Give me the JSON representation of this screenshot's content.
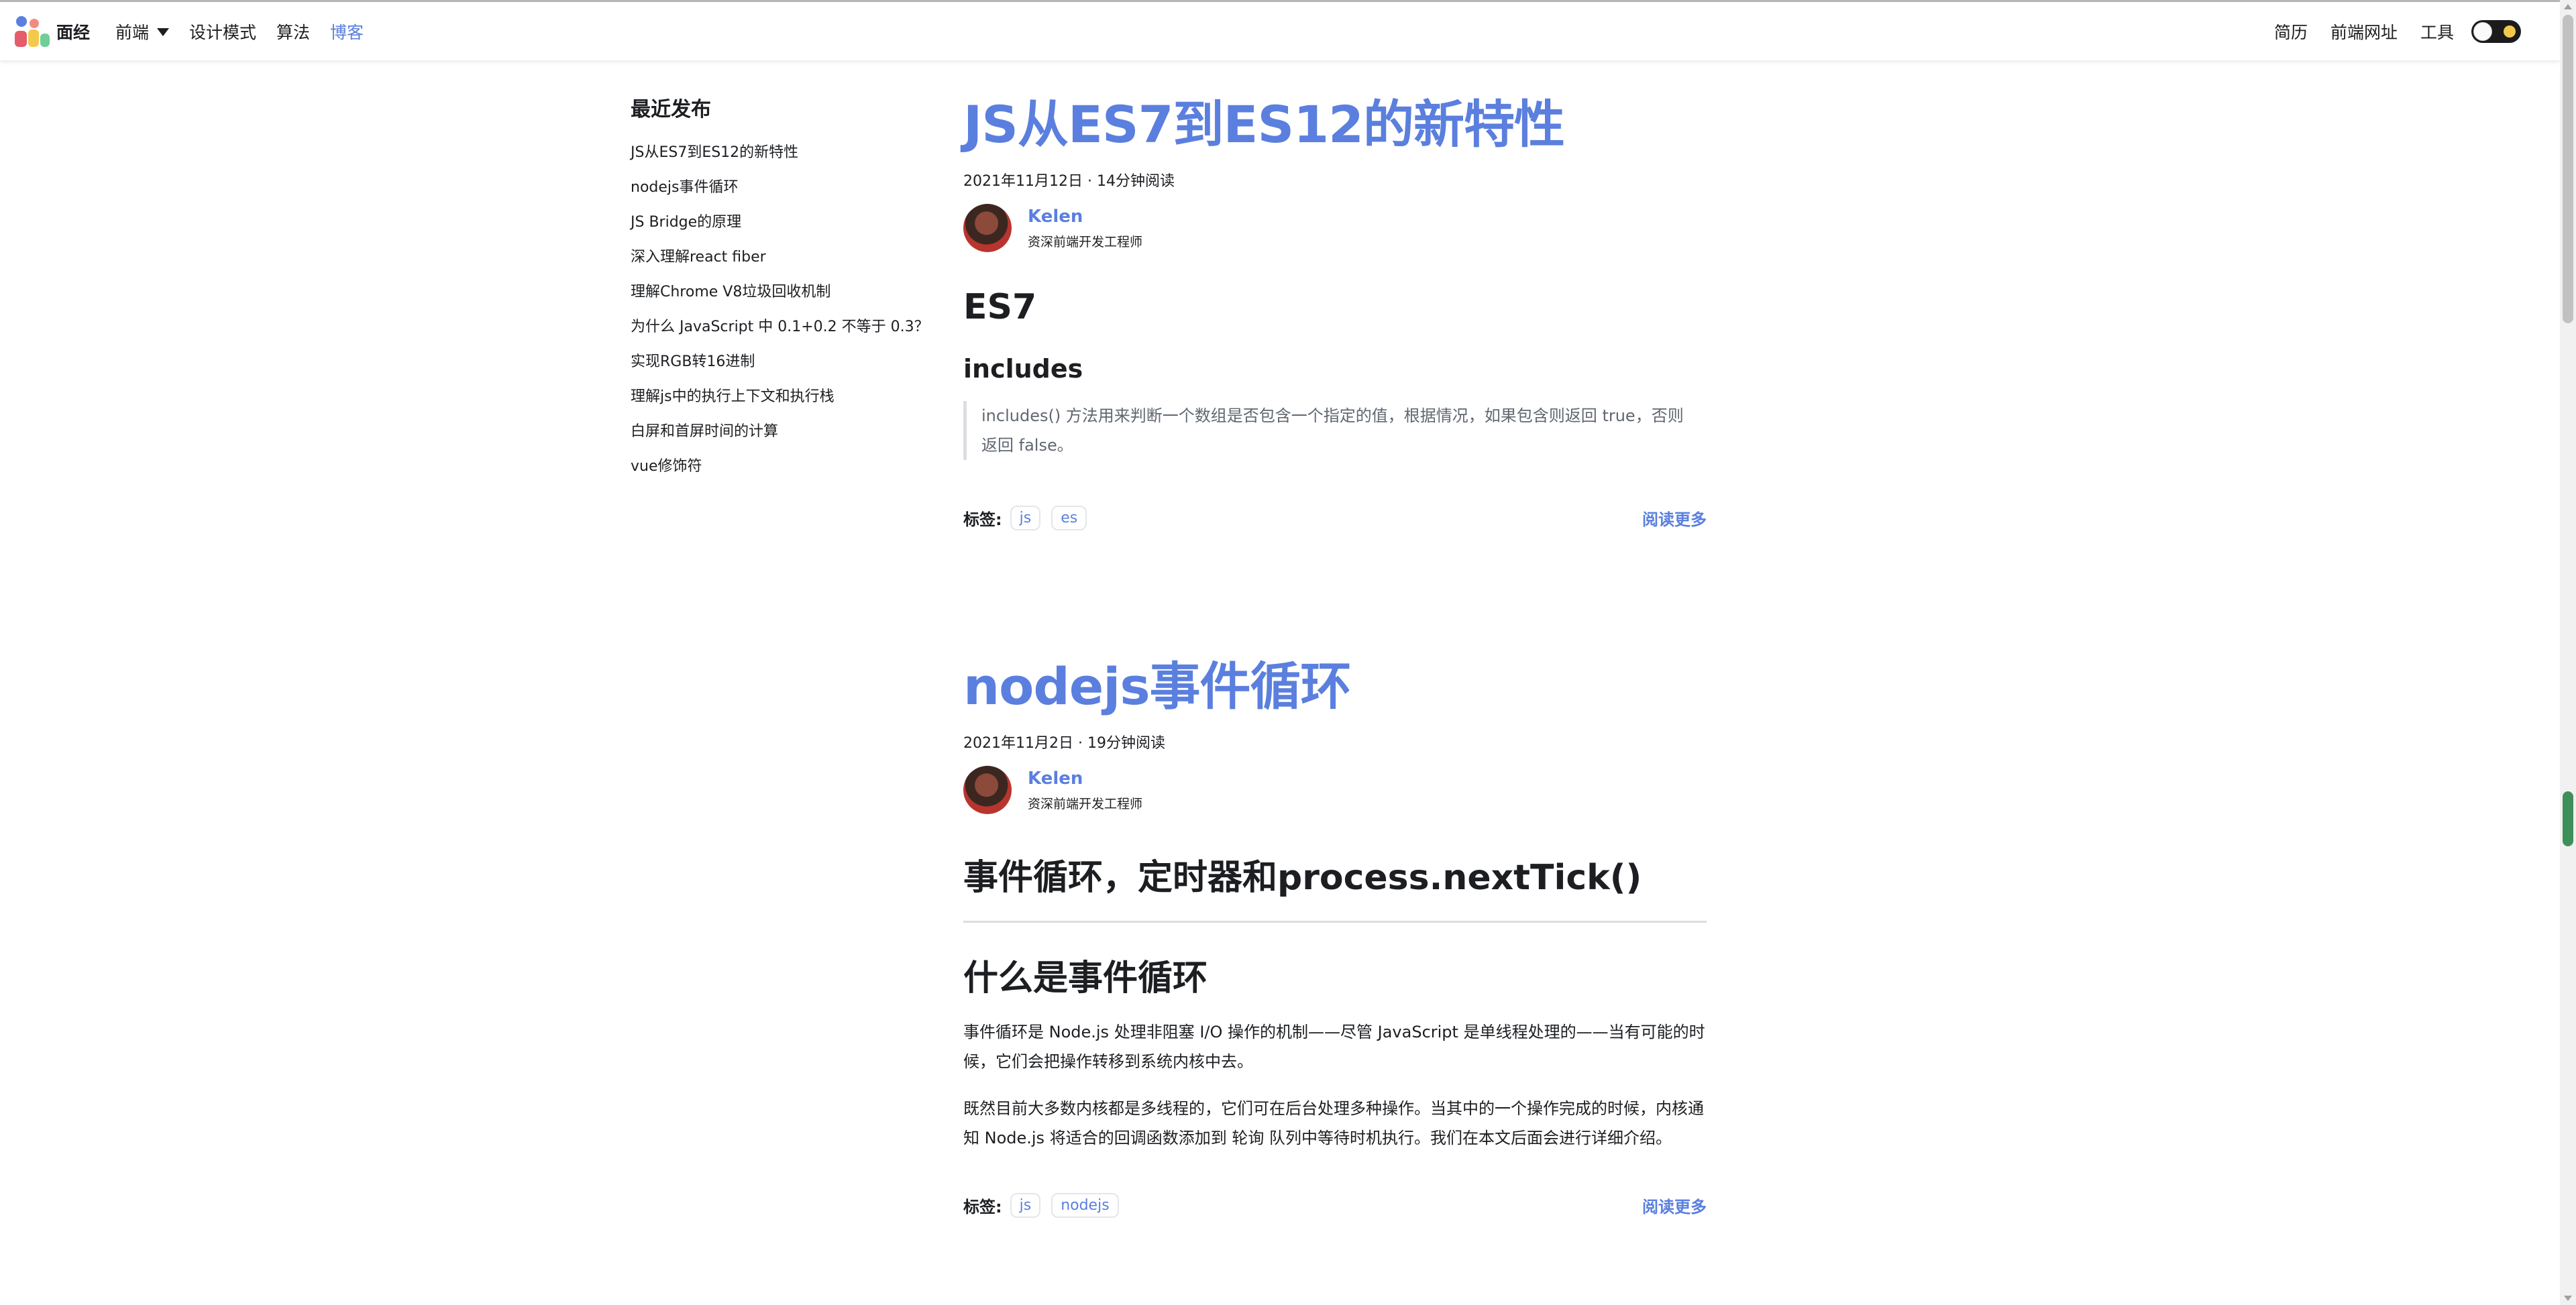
{
  "navbar": {
    "brand": "面经",
    "links_left": [
      {
        "label": "前端",
        "has_caret": true
      },
      {
        "label": "设计模式"
      },
      {
        "label": "算法"
      },
      {
        "label": "博客",
        "active": true
      }
    ],
    "links_right": [
      {
        "label": "简历"
      },
      {
        "label": "前端网址"
      },
      {
        "label": "工具"
      }
    ],
    "theme_toggle": {
      "mode": "light"
    }
  },
  "sidebar": {
    "title": "最近发布",
    "items": [
      "JS从ES7到ES12的新特性",
      "nodejs事件循环",
      "JS Bridge的原理",
      "深入理解react fiber",
      "理解Chrome V8垃圾回收机制",
      "为什么 JavaScript 中 0.1+0.2 不等于 0.3？",
      "实现RGB转16进制",
      "理解js中的执行上下文和执行栈",
      "白屏和首屏时间的计算",
      "vue修饰符"
    ]
  },
  "posts": [
    {
      "title": "JS从ES7到ES12的新特性",
      "meta": "2021年11月12日 · 14分钟阅读",
      "author": {
        "name": "Kelen",
        "role": "资深前端开发工程师"
      },
      "h1": "ES7",
      "h2": "includes",
      "quote_line1": "includes() 方法用来判断一个数组是否包含一个指定的值，根据情况，如果包含则返回 true，否则",
      "quote_line2": "返回 false。",
      "tags_label": "标签:",
      "tags": [
        "js",
        "es"
      ],
      "read_more": "阅读更多"
    },
    {
      "title": "nodejs事件循环",
      "meta": "2021年11月2日 · 19分钟阅读",
      "author": {
        "name": "Kelen",
        "role": "资深前端开发工程师"
      },
      "h1": "事件循环，定时器和process.nextTick()",
      "h1b": "什么是事件循环",
      "p1_line1": "事件循环是 Node.js 处理非阻塞 I/O 操作的机制——尽管 JavaScript 是单线程处理的——当有可能的时",
      "p1_line2": "候，它们会把操作转移到系统内核中去。",
      "p2_line1": "既然目前大多数内核都是多线程的，它们可在后台处理多种操作。当其中的一个操作完成的时候，内核通",
      "p2_line2": "知 Node.js 将适合的回调函数添加到 轮询 队列中等待时机执行。我们在本文后面会进行详细介绍。",
      "tags_label": "标签:",
      "tags": [
        "js",
        "nodejs"
      ],
      "read_more": "阅读更多"
    }
  ],
  "colors": {
    "accent": "#5b7fde",
    "text": "#1c1e21",
    "scroll_thumb_top": "#c1c1c1",
    "scroll_thumb_bottom": "#3f8f5a"
  }
}
